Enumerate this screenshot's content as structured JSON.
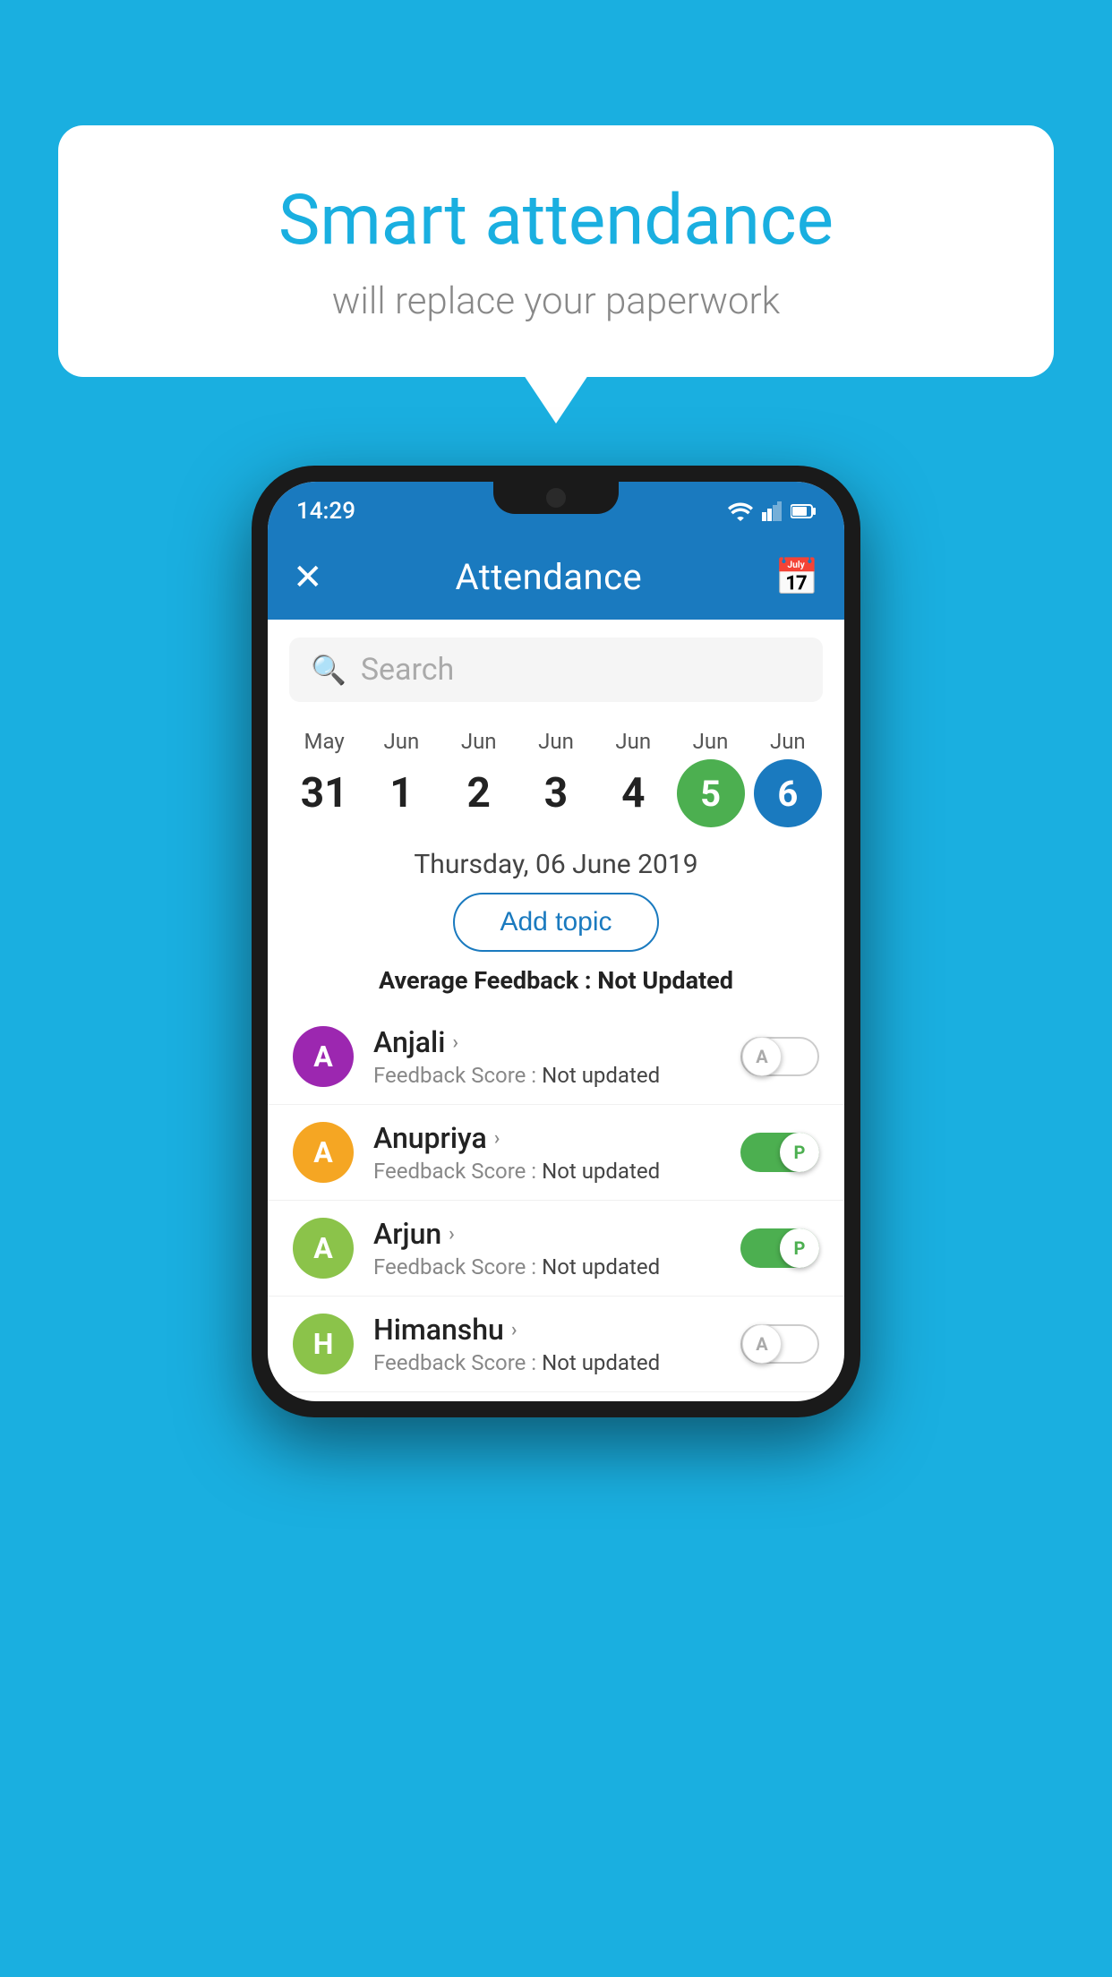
{
  "background": "#1AAFE0",
  "bubble": {
    "title": "Smart attendance",
    "subtitle": "will replace your paperwork"
  },
  "status_bar": {
    "time": "14:29"
  },
  "app_bar": {
    "title": "Attendance",
    "close_label": "✕",
    "calendar_label": "📅"
  },
  "search": {
    "placeholder": "Search"
  },
  "calendar": {
    "days": [
      {
        "month": "May",
        "date": "31",
        "style": "normal"
      },
      {
        "month": "Jun",
        "date": "1",
        "style": "normal"
      },
      {
        "month": "Jun",
        "date": "2",
        "style": "normal"
      },
      {
        "month": "Jun",
        "date": "3",
        "style": "normal"
      },
      {
        "month": "Jun",
        "date": "4",
        "style": "normal"
      },
      {
        "month": "Jun",
        "date": "5",
        "style": "today"
      },
      {
        "month": "Jun",
        "date": "6",
        "style": "selected"
      }
    ],
    "selected_date_label": "Thursday, 06 June 2019"
  },
  "add_topic": {
    "label": "Add topic"
  },
  "avg_feedback": {
    "label": "Average Feedback : ",
    "value": "Not Updated"
  },
  "students": [
    {
      "name": "Anjali",
      "avatar_letter": "A",
      "avatar_color": "#9C27B0",
      "feedback_label": "Feedback Score : ",
      "feedback_value": "Not updated",
      "toggle": "off",
      "toggle_letter": "A"
    },
    {
      "name": "Anupriya",
      "avatar_letter": "A",
      "avatar_color": "#F5A623",
      "feedback_label": "Feedback Score : ",
      "feedback_value": "Not updated",
      "toggle": "on",
      "toggle_letter": "P"
    },
    {
      "name": "Arjun",
      "avatar_letter": "A",
      "avatar_color": "#8BC34A",
      "feedback_label": "Feedback Score : ",
      "feedback_value": "Not updated",
      "toggle": "on",
      "toggle_letter": "P"
    },
    {
      "name": "Himanshu",
      "avatar_letter": "H",
      "avatar_color": "#8BC34A",
      "feedback_label": "Feedback Score : ",
      "feedback_value": "Not updated",
      "toggle": "off",
      "toggle_letter": "A"
    }
  ]
}
